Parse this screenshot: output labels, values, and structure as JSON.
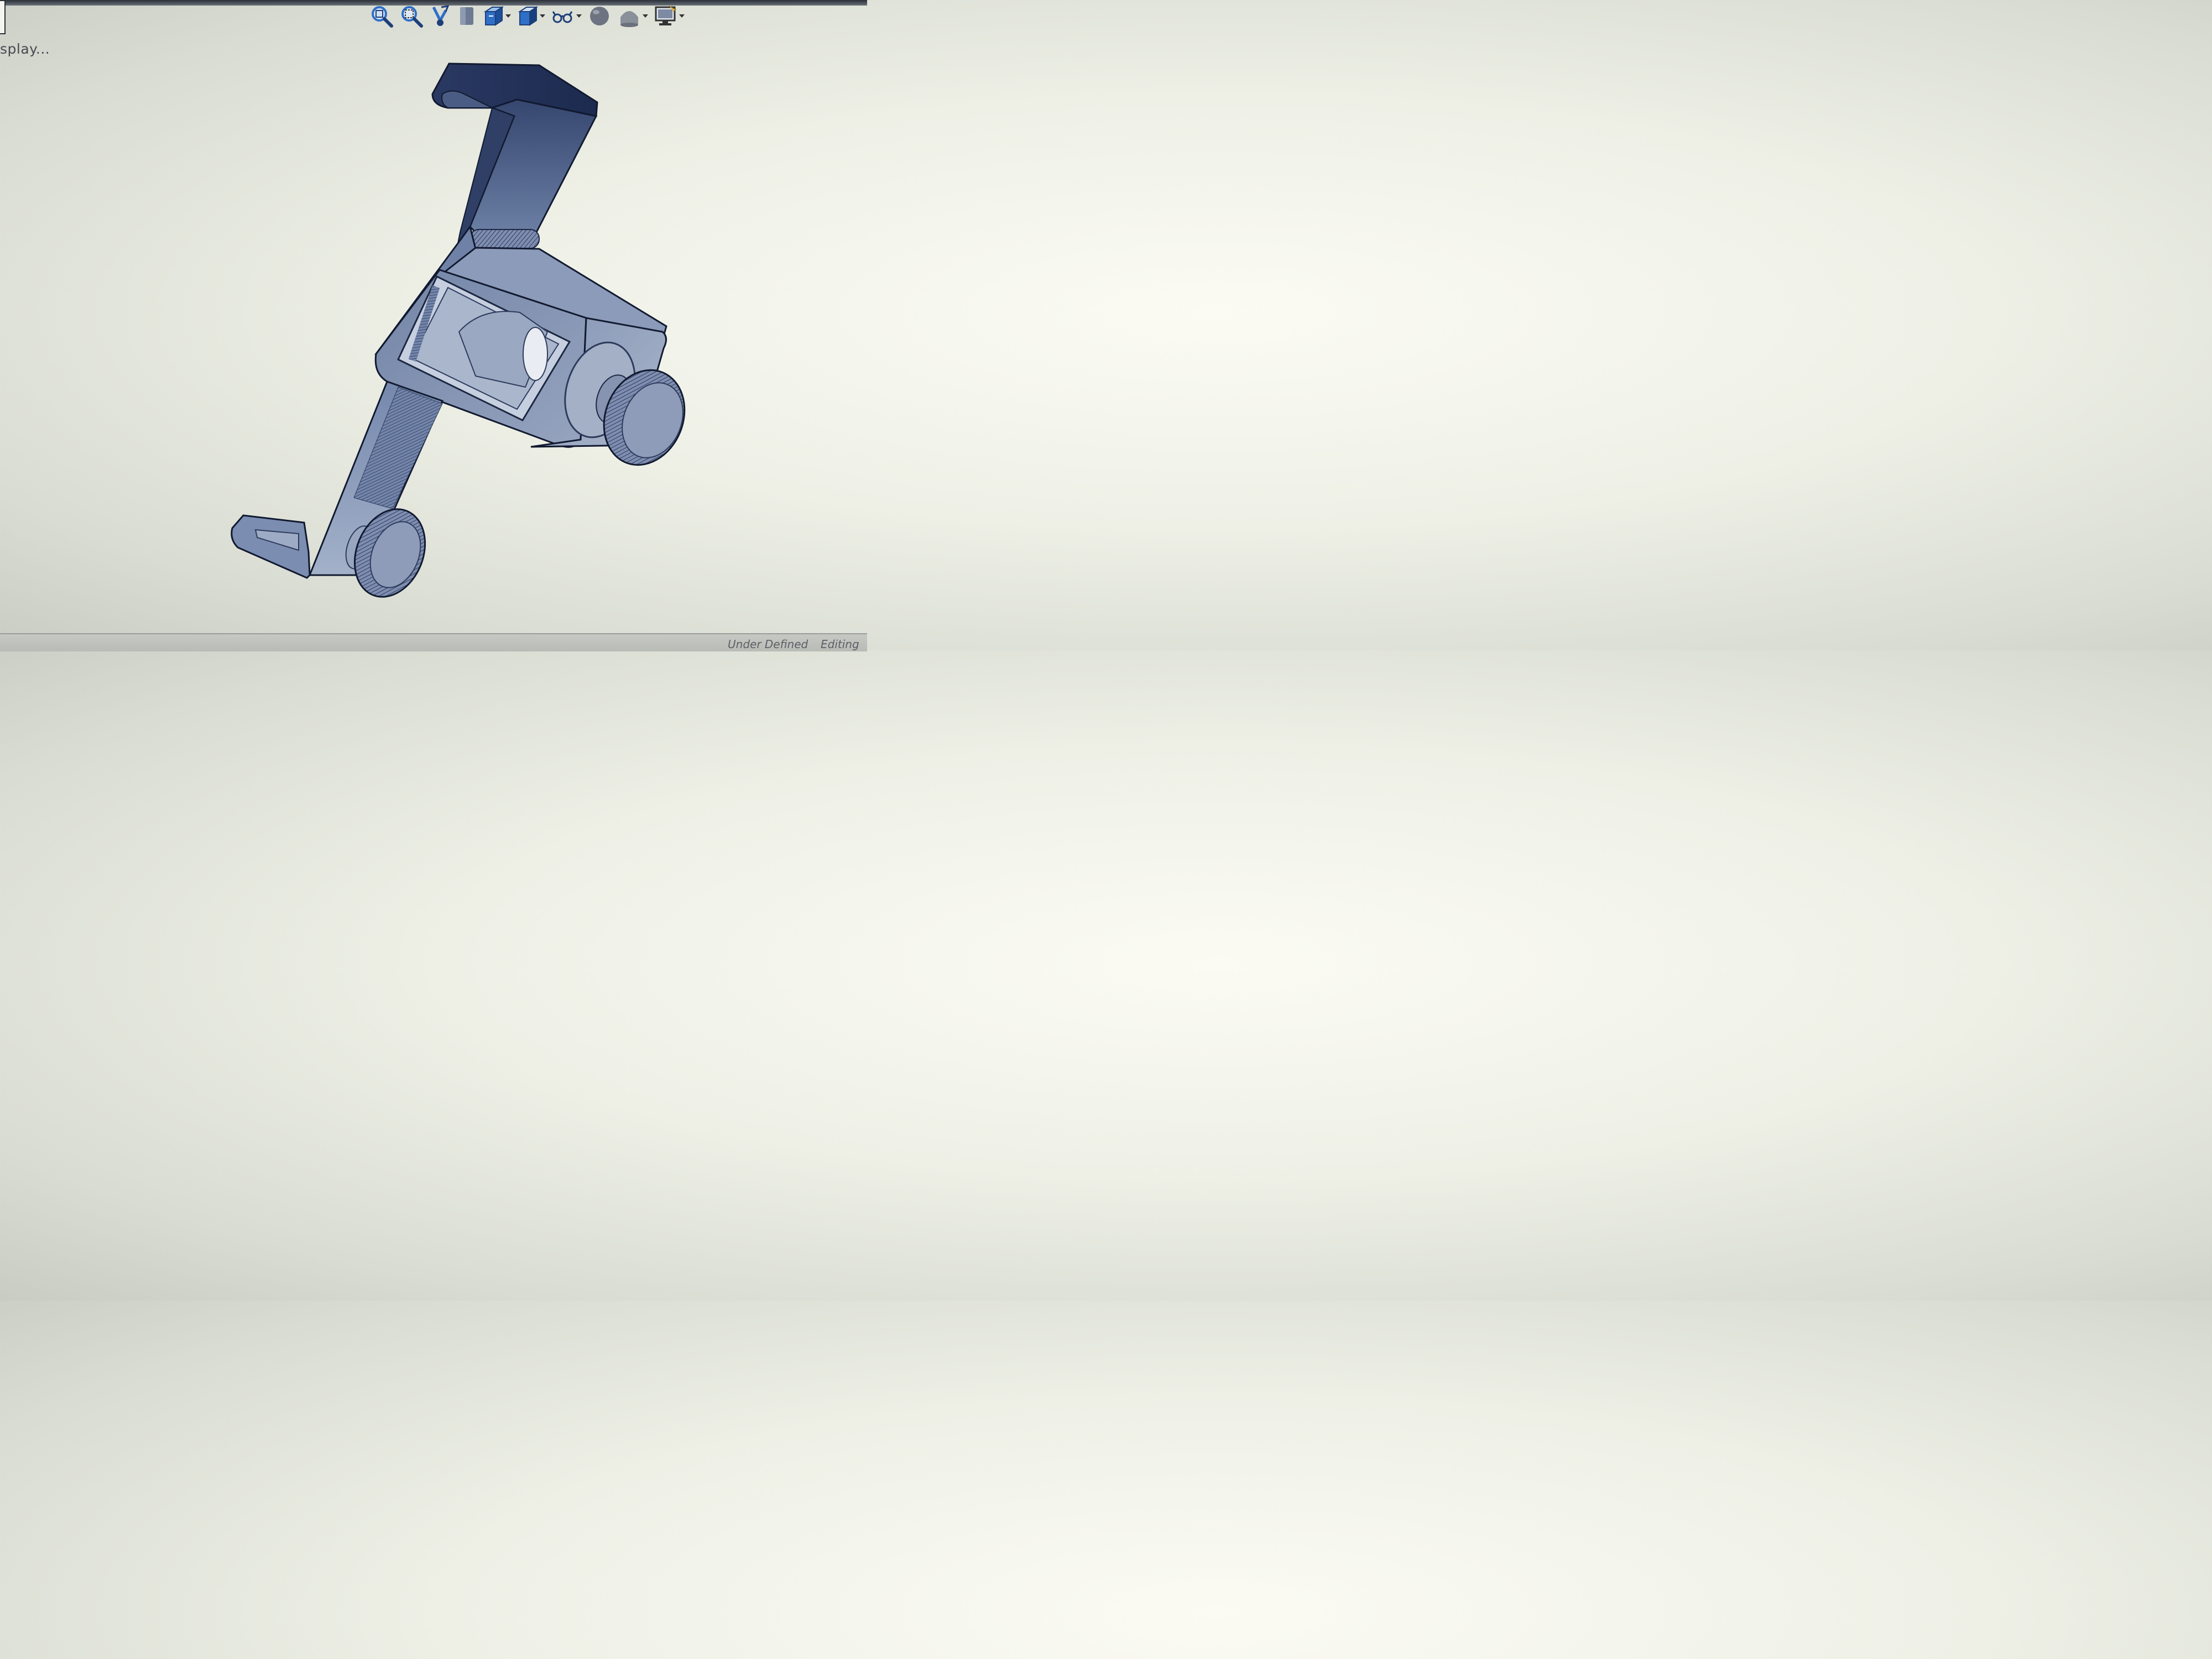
{
  "window": {
    "display_label": "splay..."
  },
  "toolbar": {
    "buttons": [
      {
        "name": "zoom-to-fit",
        "icon": "zoom-to-fit-icon",
        "dropdown": false
      },
      {
        "name": "zoom-to-area",
        "icon": "zoom-to-area-icon",
        "dropdown": false
      },
      {
        "name": "previous-view",
        "icon": "previous-view-icon",
        "dropdown": false
      },
      {
        "name": "section-view",
        "icon": "section-view-icon",
        "dropdown": false
      },
      {
        "name": "dynamic-annotation",
        "icon": "view-orientation-icon",
        "dropdown": true
      },
      {
        "name": "display-style",
        "icon": "display-style-icon",
        "dropdown": true
      },
      {
        "name": "hide-show-items",
        "icon": "hide-show-items-icon",
        "dropdown": true
      },
      {
        "name": "edit-appearance",
        "icon": "edit-appearance-icon",
        "dropdown": false
      },
      {
        "name": "apply-scene",
        "icon": "apply-scene-icon",
        "dropdown": true
      },
      {
        "name": "view-settings",
        "icon": "view-settings-icon",
        "dropdown": true
      }
    ]
  },
  "status": {
    "state": "Under Defined",
    "mode": "Editing"
  },
  "colors": {
    "model_dark": "#1f2f55",
    "model_mid": "#5c6f96",
    "model_light": "#a9b5cc",
    "toolbar_blue": "#2f6fc8"
  }
}
